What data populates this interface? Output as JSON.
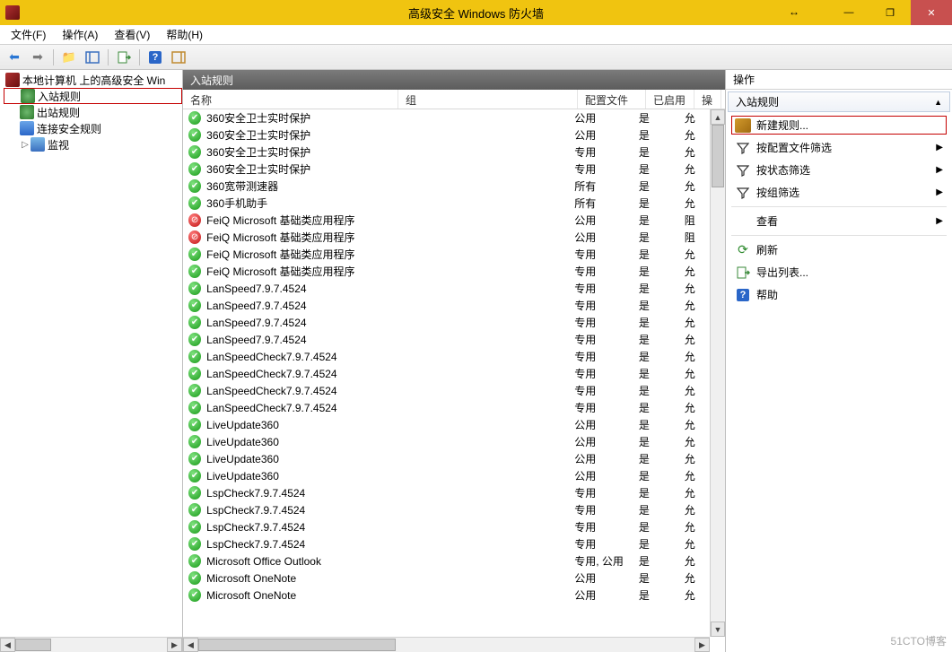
{
  "window": {
    "title": "高级安全 Windows 防火墙",
    "min": "—",
    "max": "❐",
    "close": "✕",
    "move": "↔"
  },
  "menu": {
    "file": "文件(F)",
    "action": "操作(A)",
    "view": "查看(V)",
    "help": "帮助(H)"
  },
  "tree": {
    "root": "本地计算机 上的高级安全 Win",
    "inbound": "入站规则",
    "outbound": "出站规则",
    "connsec": "连接安全规则",
    "monitor": "监视"
  },
  "list": {
    "title": "入站规则",
    "columns": {
      "name": "名称",
      "group": "组",
      "profile": "配置文件",
      "enabled": "已启用",
      "action": "操"
    },
    "rules": [
      {
        "status": "allow",
        "name": "360安全卫士实时保护",
        "group": "",
        "profile": "公用",
        "enabled": "是",
        "action": "允"
      },
      {
        "status": "allow",
        "name": "360安全卫士实时保护",
        "group": "",
        "profile": "公用",
        "enabled": "是",
        "action": "允"
      },
      {
        "status": "allow",
        "name": "360安全卫士实时保护",
        "group": "",
        "profile": "专用",
        "enabled": "是",
        "action": "允"
      },
      {
        "status": "allow",
        "name": "360安全卫士实时保护",
        "group": "",
        "profile": "专用",
        "enabled": "是",
        "action": "允"
      },
      {
        "status": "allow",
        "name": "360宽带测速器",
        "group": "",
        "profile": "所有",
        "enabled": "是",
        "action": "允"
      },
      {
        "status": "allow",
        "name": "360手机助手",
        "group": "",
        "profile": "所有",
        "enabled": "是",
        "action": "允"
      },
      {
        "status": "block",
        "name": "FeiQ Microsoft 基础类应用程序",
        "group": "",
        "profile": "公用",
        "enabled": "是",
        "action": "阻"
      },
      {
        "status": "block",
        "name": "FeiQ Microsoft 基础类应用程序",
        "group": "",
        "profile": "公用",
        "enabled": "是",
        "action": "阻"
      },
      {
        "status": "allow",
        "name": "FeiQ Microsoft 基础类应用程序",
        "group": "",
        "profile": "专用",
        "enabled": "是",
        "action": "允"
      },
      {
        "status": "allow",
        "name": "FeiQ Microsoft 基础类应用程序",
        "group": "",
        "profile": "专用",
        "enabled": "是",
        "action": "允"
      },
      {
        "status": "allow",
        "name": "LanSpeed7.9.7.4524",
        "group": "",
        "profile": "专用",
        "enabled": "是",
        "action": "允"
      },
      {
        "status": "allow",
        "name": "LanSpeed7.9.7.4524",
        "group": "",
        "profile": "专用",
        "enabled": "是",
        "action": "允"
      },
      {
        "status": "allow",
        "name": "LanSpeed7.9.7.4524",
        "group": "",
        "profile": "专用",
        "enabled": "是",
        "action": "允"
      },
      {
        "status": "allow",
        "name": "LanSpeed7.9.7.4524",
        "group": "",
        "profile": "专用",
        "enabled": "是",
        "action": "允"
      },
      {
        "status": "allow",
        "name": "LanSpeedCheck7.9.7.4524",
        "group": "",
        "profile": "专用",
        "enabled": "是",
        "action": "允"
      },
      {
        "status": "allow",
        "name": "LanSpeedCheck7.9.7.4524",
        "group": "",
        "profile": "专用",
        "enabled": "是",
        "action": "允"
      },
      {
        "status": "allow",
        "name": "LanSpeedCheck7.9.7.4524",
        "group": "",
        "profile": "专用",
        "enabled": "是",
        "action": "允"
      },
      {
        "status": "allow",
        "name": "LanSpeedCheck7.9.7.4524",
        "group": "",
        "profile": "专用",
        "enabled": "是",
        "action": "允"
      },
      {
        "status": "allow",
        "name": "LiveUpdate360",
        "group": "",
        "profile": "公用",
        "enabled": "是",
        "action": "允"
      },
      {
        "status": "allow",
        "name": "LiveUpdate360",
        "group": "",
        "profile": "公用",
        "enabled": "是",
        "action": "允"
      },
      {
        "status": "allow",
        "name": "LiveUpdate360",
        "group": "",
        "profile": "公用",
        "enabled": "是",
        "action": "允"
      },
      {
        "status": "allow",
        "name": "LiveUpdate360",
        "group": "",
        "profile": "公用",
        "enabled": "是",
        "action": "允"
      },
      {
        "status": "allow",
        "name": "LspCheck7.9.7.4524",
        "group": "",
        "profile": "专用",
        "enabled": "是",
        "action": "允"
      },
      {
        "status": "allow",
        "name": "LspCheck7.9.7.4524",
        "group": "",
        "profile": "专用",
        "enabled": "是",
        "action": "允"
      },
      {
        "status": "allow",
        "name": "LspCheck7.9.7.4524",
        "group": "",
        "profile": "专用",
        "enabled": "是",
        "action": "允"
      },
      {
        "status": "allow",
        "name": "LspCheck7.9.7.4524",
        "group": "",
        "profile": "专用",
        "enabled": "是",
        "action": "允"
      },
      {
        "status": "allow",
        "name": "Microsoft Office Outlook",
        "group": "",
        "profile": "专用, 公用",
        "enabled": "是",
        "action": "允"
      },
      {
        "status": "allow",
        "name": "Microsoft OneNote",
        "group": "",
        "profile": "公用",
        "enabled": "是",
        "action": "允"
      },
      {
        "status": "allow",
        "name": "Microsoft OneNote",
        "group": "",
        "profile": "公用",
        "enabled": "是",
        "action": "允"
      }
    ]
  },
  "actions": {
    "header": "操作",
    "section": "入站规则",
    "items": {
      "new_rule": "新建规则...",
      "filter_profile": "按配置文件筛选",
      "filter_status": "按状态筛选",
      "filter_group": "按组筛选",
      "view": "查看",
      "refresh": "刷新",
      "export": "导出列表...",
      "help": "帮助"
    }
  },
  "watermark": "51CTO博客"
}
